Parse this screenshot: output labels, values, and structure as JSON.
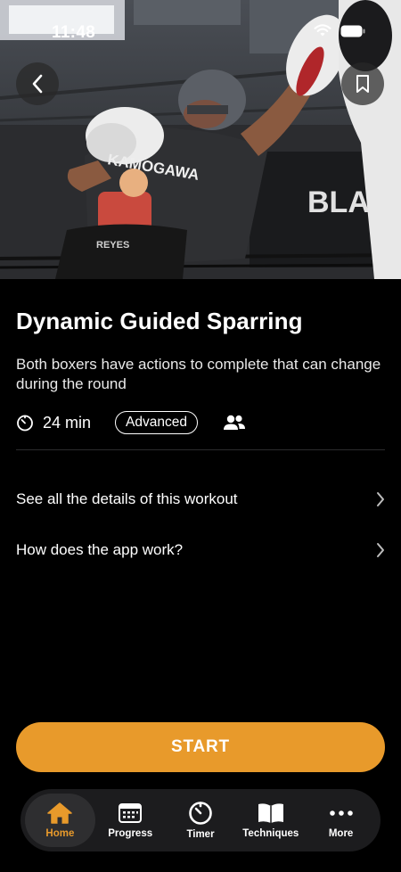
{
  "status": {
    "time": "11:48"
  },
  "workout": {
    "title": "Dynamic Guided Sparring",
    "description": "Both boxers have actions to complete that can change during the round",
    "duration": "24 min",
    "level": "Advanced"
  },
  "hero": {
    "shirt_text": "KAMOGAWA",
    "belt_text": "REYES",
    "bg_text": "BLACK-BOX"
  },
  "links": [
    {
      "label": "See all the details of this workout"
    },
    {
      "label": "How does the app work?"
    }
  ],
  "start_label": "START",
  "tabs": [
    {
      "label": "Home",
      "icon": "home-icon",
      "active": true
    },
    {
      "label": "Progress",
      "icon": "calendar-icon",
      "active": false
    },
    {
      "label": "Timer",
      "icon": "timer-icon",
      "active": false
    },
    {
      "label": "Techniques",
      "icon": "book-icon",
      "active": false
    },
    {
      "label": "More",
      "icon": "more-icon",
      "active": false
    }
  ],
  "colors": {
    "accent": "#e89a2b",
    "background": "#000000",
    "tabbar": "#1c1c1e"
  }
}
